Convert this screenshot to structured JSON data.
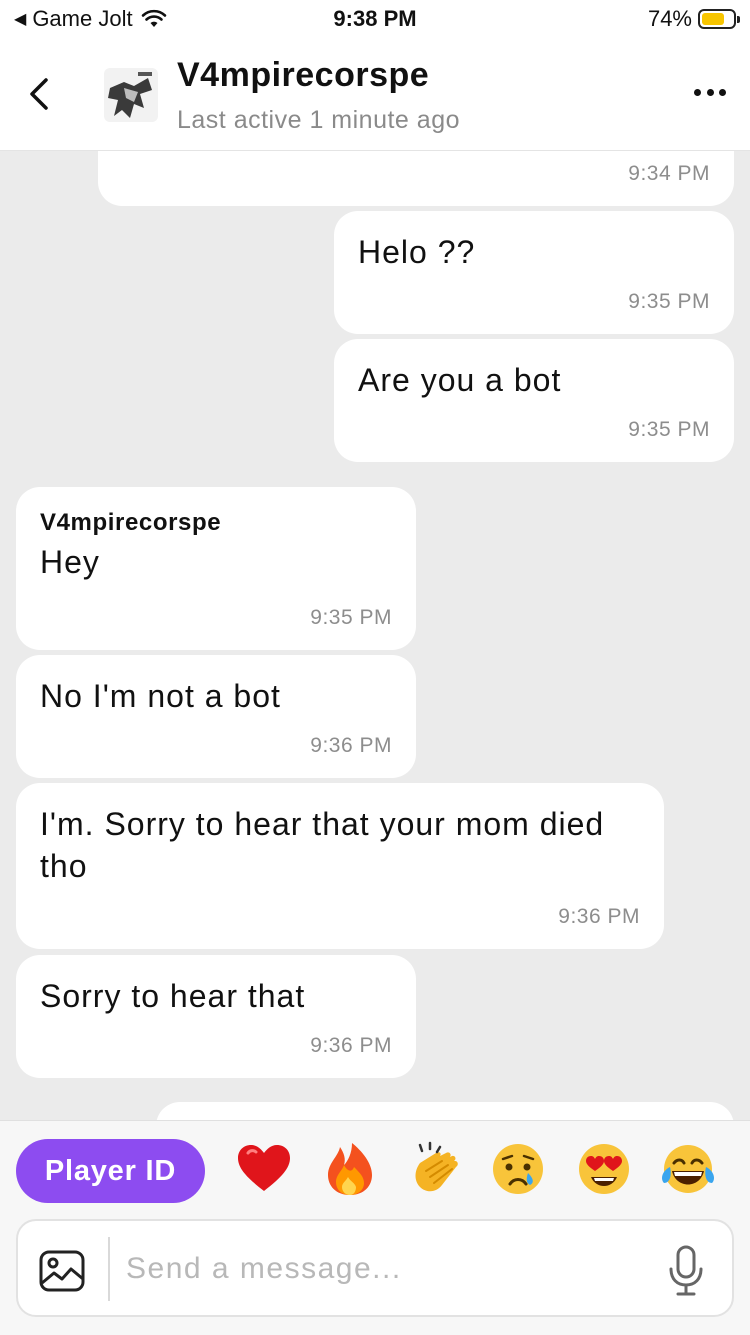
{
  "status_bar": {
    "back_app": "Game Jolt",
    "time": "9:38 PM",
    "battery_percent": "74%",
    "battery_level": 0.74,
    "battery_color": "#f7c500"
  },
  "header": {
    "contact_name": "V4mpirecorspe",
    "last_active": "Last active 1 minute ago",
    "back_icon": "chevron-left-icon",
    "more_icon": "more-horizontal-icon"
  },
  "messages": [
    {
      "side": "right",
      "sender": "",
      "text": "",
      "time": "9:34 PM"
    },
    {
      "side": "right",
      "sender": "",
      "text": "Helo ??",
      "time": "9:35 PM"
    },
    {
      "side": "right",
      "sender": "",
      "text": "Are you a bot",
      "time": "9:35 PM"
    },
    {
      "side": "left",
      "sender": "V4mpirecorspe",
      "text": "Hey",
      "time": "9:35 PM"
    },
    {
      "side": "left",
      "sender": "",
      "text": "No I'm not a bot",
      "time": "9:36 PM"
    },
    {
      "side": "left",
      "sender": "",
      "text": "I'm. Sorry to hear that your mom died tho",
      "time": "9:36 PM"
    },
    {
      "side": "left",
      "sender": "",
      "text": "Sorry to hear that",
      "time": "9:36 PM"
    }
  ],
  "composer": {
    "player_id_label": "Player ID",
    "reactions": [
      "red-heart-emoji",
      "fire-emoji",
      "clapping-hands-emoji",
      "crying-face-emoji",
      "heart-eyes-emoji",
      "tears-of-joy-emoji"
    ],
    "placeholder": "Send a message...",
    "accent_color": "#8d4cf0"
  }
}
